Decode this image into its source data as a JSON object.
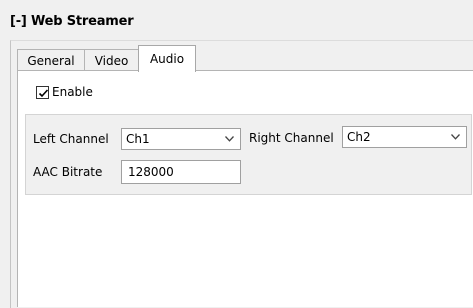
{
  "panel": {
    "title": "[-] Web Streamer"
  },
  "tabs": [
    {
      "label": "General",
      "active": false
    },
    {
      "label": "Video",
      "active": false
    },
    {
      "label": "Audio",
      "active": true
    }
  ],
  "audio": {
    "enable": {
      "label": "Enable",
      "checked": true
    },
    "left_channel": {
      "label": "Left Channel",
      "value": "Ch1"
    },
    "right_channel": {
      "label": "Right Channel",
      "value": "Ch2"
    },
    "aac_bitrate": {
      "label": "AAC Bitrate",
      "value": "128000"
    }
  },
  "icons": {
    "check": "check-icon",
    "dropdown": "chevron-down-icon"
  }
}
